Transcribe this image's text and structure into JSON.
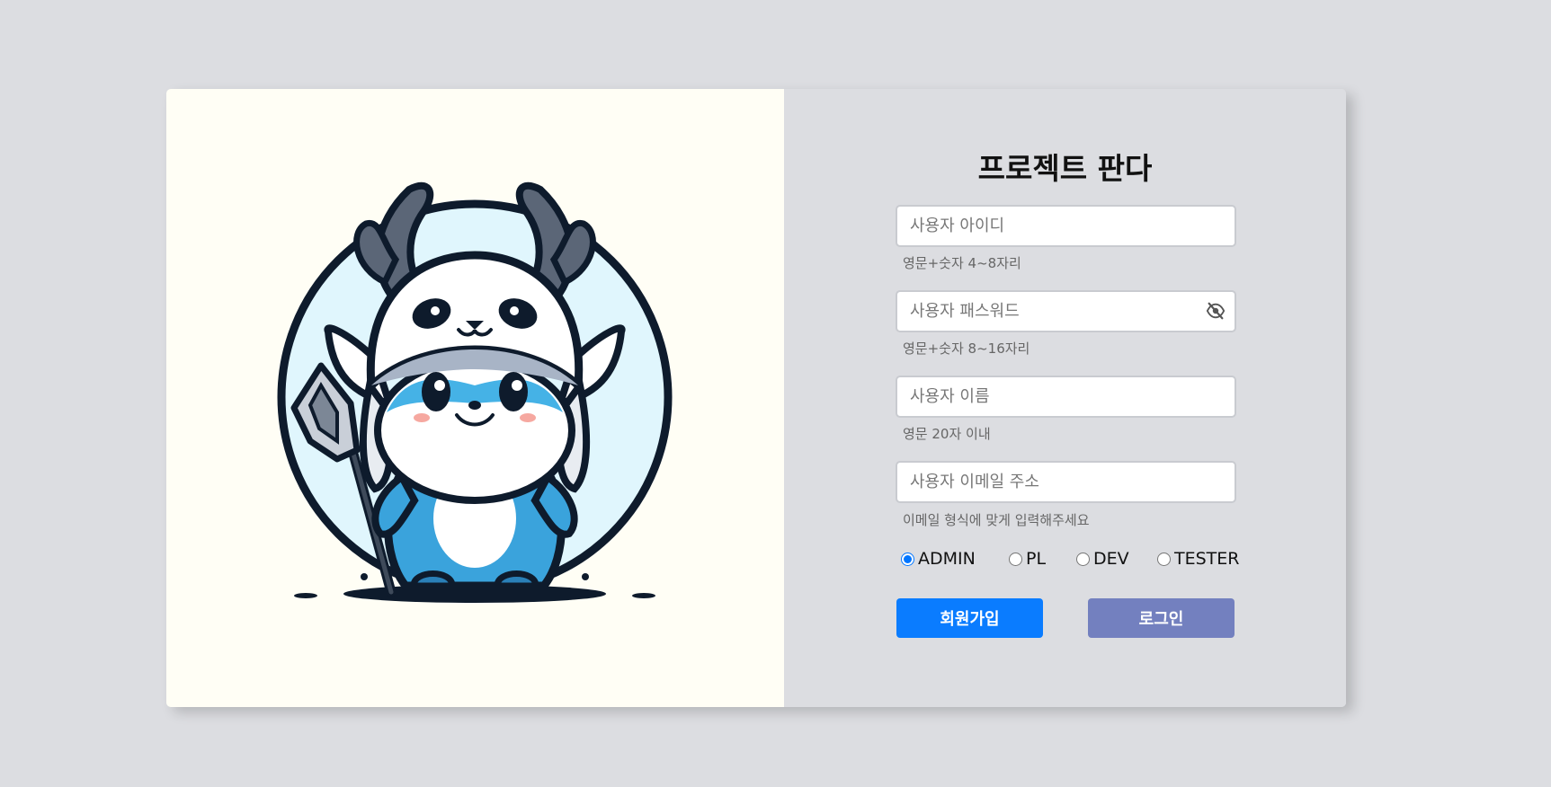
{
  "title": "프로젝트 판다",
  "form": {
    "user_id": {
      "placeholder": "사용자 아이디",
      "hint": "영문+숫자 4~8자리"
    },
    "password": {
      "placeholder": "사용자 패스워드",
      "hint": "영문+숫자 8~16자리",
      "toggle_icon": "eye-slash-icon"
    },
    "name": {
      "placeholder": "사용자 이름",
      "hint": "영문 20자 이내"
    },
    "email": {
      "placeholder": "사용자 이메일 주소",
      "hint": "이메일 형식에 맞게 입력해주세요"
    },
    "roles": [
      {
        "label": "ADMIN",
        "checked": true
      },
      {
        "label": "PL",
        "checked": false
      },
      {
        "label": "DEV",
        "checked": false
      },
      {
        "label": "TESTER",
        "checked": false
      }
    ],
    "signup_label": "회원가입",
    "login_label": "로그인"
  },
  "colors": {
    "signup_button": "#0a7cff",
    "login_button": "#7380bf",
    "left_panel_bg": "#fffef5",
    "page_bg": "#dcdde1"
  },
  "illustration": {
    "icon": "panda-deer-mascot-illustration"
  }
}
